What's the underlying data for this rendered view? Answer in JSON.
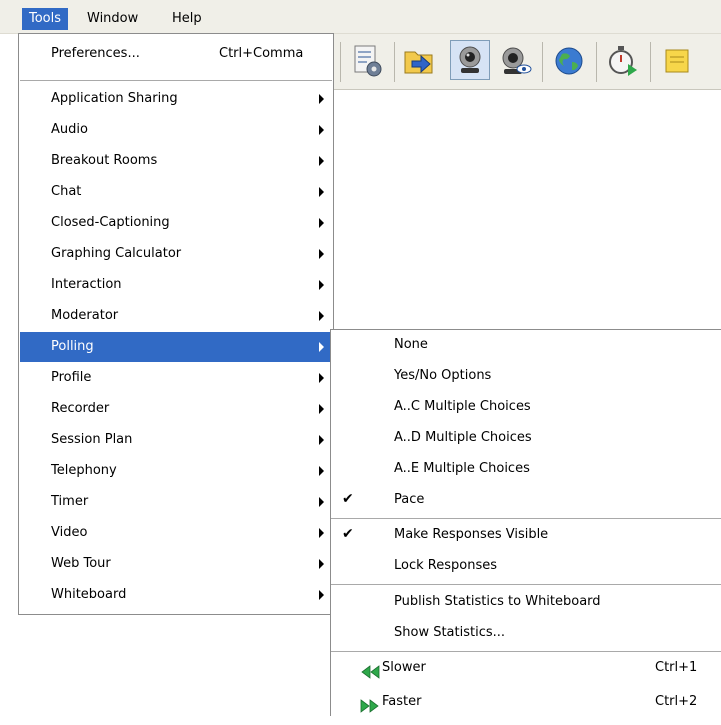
{
  "menubar": {
    "tools": "Tools",
    "window": "Window",
    "help": "Help"
  },
  "tools_menu": {
    "preferences": {
      "label": "Preferences...",
      "accel": "Ctrl+Comma"
    },
    "items": [
      "Application Sharing",
      "Audio",
      "Breakout Rooms",
      "Chat",
      "Closed-Captioning",
      "Graphing Calculator",
      "Interaction",
      "Moderator",
      "Polling",
      "Profile",
      "Recorder",
      "Session Plan",
      "Telephony",
      "Timer",
      "Video",
      "Web Tour",
      "Whiteboard"
    ],
    "highlighted": "Polling"
  },
  "polling_submenu": {
    "none": "None",
    "yes_no": "Yes/No Options",
    "ac": "A..C Multiple Choices",
    "ad": "A..D Multiple Choices",
    "ae": "A..E Multiple Choices",
    "pace": "Pace",
    "check": "✔",
    "make_visible": "Make Responses Visible",
    "lock": "Lock Responses",
    "publish": "Publish Statistics to Whiteboard",
    "show_stats": "Show Statistics...",
    "slower": {
      "label": "Slower",
      "accel": "Ctrl+1"
    },
    "faster": {
      "label": "Faster",
      "accel": "Ctrl+2"
    }
  },
  "toolbar_icons": [
    "preferences-icon",
    "load-content-icon",
    "webcam-icon",
    "webcam-preview-icon",
    "web-tour-icon",
    "timer-icon",
    "notes-icon"
  ],
  "colors": {
    "highlight": "#316ac5",
    "menubar": "#f0efe8",
    "speed_arrows": "#2ea84a"
  }
}
